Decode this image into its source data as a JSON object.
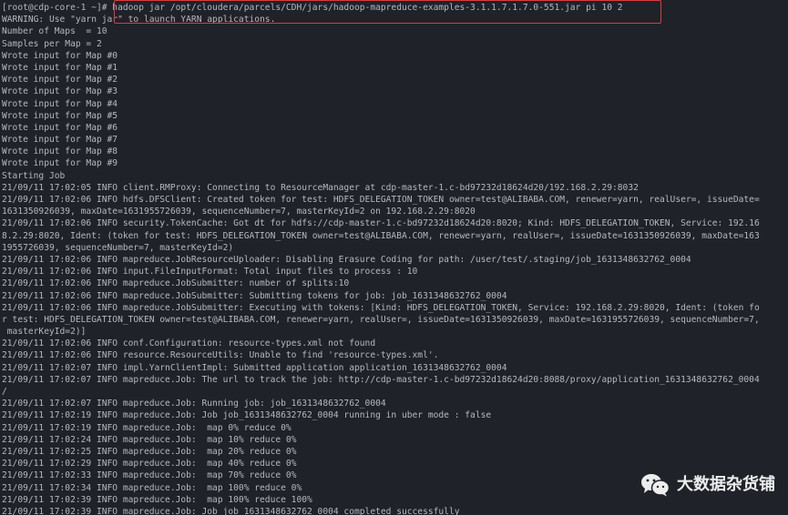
{
  "terminal": {
    "lines": [
      "[root@cdp-core-1 ~]# hadoop jar /opt/cloudera/parcels/CDH/jars/hadoop-mapreduce-examples-3.1.1.7.1.7.0-551.jar pi 10 2",
      "WARNING: Use \"yarn jar\" to launch YARN applications.",
      "Number of Maps  = 10",
      "Samples per Map = 2",
      "Wrote input for Map #0",
      "Wrote input for Map #1",
      "Wrote input for Map #2",
      "Wrote input for Map #3",
      "Wrote input for Map #4",
      "Wrote input for Map #5",
      "Wrote input for Map #6",
      "Wrote input for Map #7",
      "Wrote input for Map #8",
      "Wrote input for Map #9",
      "Starting Job",
      "21/09/11 17:02:05 INFO client.RMProxy: Connecting to ResourceManager at cdp-master-1.c-bd97232d18624d20/192.168.2.29:8032",
      "21/09/11 17:02:06 INFO hdfs.DFSClient: Created token for test: HDFS_DELEGATION_TOKEN owner=test@ALIBABA.COM, renewer=yarn, realUser=, issueDate=",
      "1631350926039, maxDate=1631955726039, sequenceNumber=7, masterKeyId=2 on 192.168.2.29:8020",
      "21/09/11 17:02:06 INFO security.TokenCache: Got dt for hdfs://cdp-master-1.c-bd97232d18624d20:8020; Kind: HDFS_DELEGATION_TOKEN, Service: 192.16",
      "8.2.29:8020, Ident: (token for test: HDFS_DELEGATION_TOKEN owner=test@ALIBABA.COM, renewer=yarn, realUser=, issueDate=1631350926039, maxDate=163",
      "1955726039, sequenceNumber=7, masterKeyId=2)",
      "21/09/11 17:02:06 INFO mapreduce.JobResourceUploader: Disabling Erasure Coding for path: /user/test/.staging/job_1631348632762_0004",
      "21/09/11 17:02:06 INFO input.FileInputFormat: Total input files to process : 10",
      "21/09/11 17:02:06 INFO mapreduce.JobSubmitter: number of splits:10",
      "21/09/11 17:02:06 INFO mapreduce.JobSubmitter: Submitting tokens for job: job_1631348632762_0004",
      "21/09/11 17:02:06 INFO mapreduce.JobSubmitter: Executing with tokens: [Kind: HDFS_DELEGATION_TOKEN, Service: 192.168.2.29:8020, Ident: (token fo",
      "r test: HDFS_DELEGATION_TOKEN owner=test@ALIBABA.COM, renewer=yarn, realUser=, issueDate=1631350926039, maxDate=1631955726039, sequenceNumber=7,",
      " masterKeyId=2)]",
      "21/09/11 17:02:06 INFO conf.Configuration: resource-types.xml not found",
      "21/09/11 17:02:06 INFO resource.ResourceUtils: Unable to find 'resource-types.xml'.",
      "21/09/11 17:02:07 INFO impl.YarnClientImpl: Submitted application application_1631348632762_0004",
      "21/09/11 17:02:07 INFO mapreduce.Job: The url to track the job: http://cdp-master-1.c-bd97232d18624d20:8088/proxy/application_1631348632762_0004",
      "/",
      "21/09/11 17:02:07 INFO mapreduce.Job: Running job: job_1631348632762_0004",
      "21/09/11 17:02:19 INFO mapreduce.Job: Job job_1631348632762_0004 running in uber mode : false",
      "21/09/11 17:02:19 INFO mapreduce.Job:  map 0% reduce 0%",
      "21/09/11 17:02:24 INFO mapreduce.Job:  map 10% reduce 0%",
      "21/09/11 17:02:25 INFO mapreduce.Job:  map 20% reduce 0%",
      "21/09/11 17:02:29 INFO mapreduce.Job:  map 40% reduce 0%",
      "21/09/11 17:02:33 INFO mapreduce.Job:  map 70% reduce 0%",
      "21/09/11 17:02:34 INFO mapreduce.Job:  map 100% reduce 0%",
      "21/09/11 17:02:39 INFO mapreduce.Job:  map 100% reduce 100%",
      "21/09/11 17:02:39 INFO mapreduce.Job: Job job_1631348632762_0004 completed successfully"
    ]
  },
  "watermark": {
    "text": "大数据杂货铺",
    "icon": "wechat-icon"
  },
  "colors": {
    "background": "#1f2228",
    "text": "#b4b9c0",
    "highlight": "#e03a3a"
  }
}
